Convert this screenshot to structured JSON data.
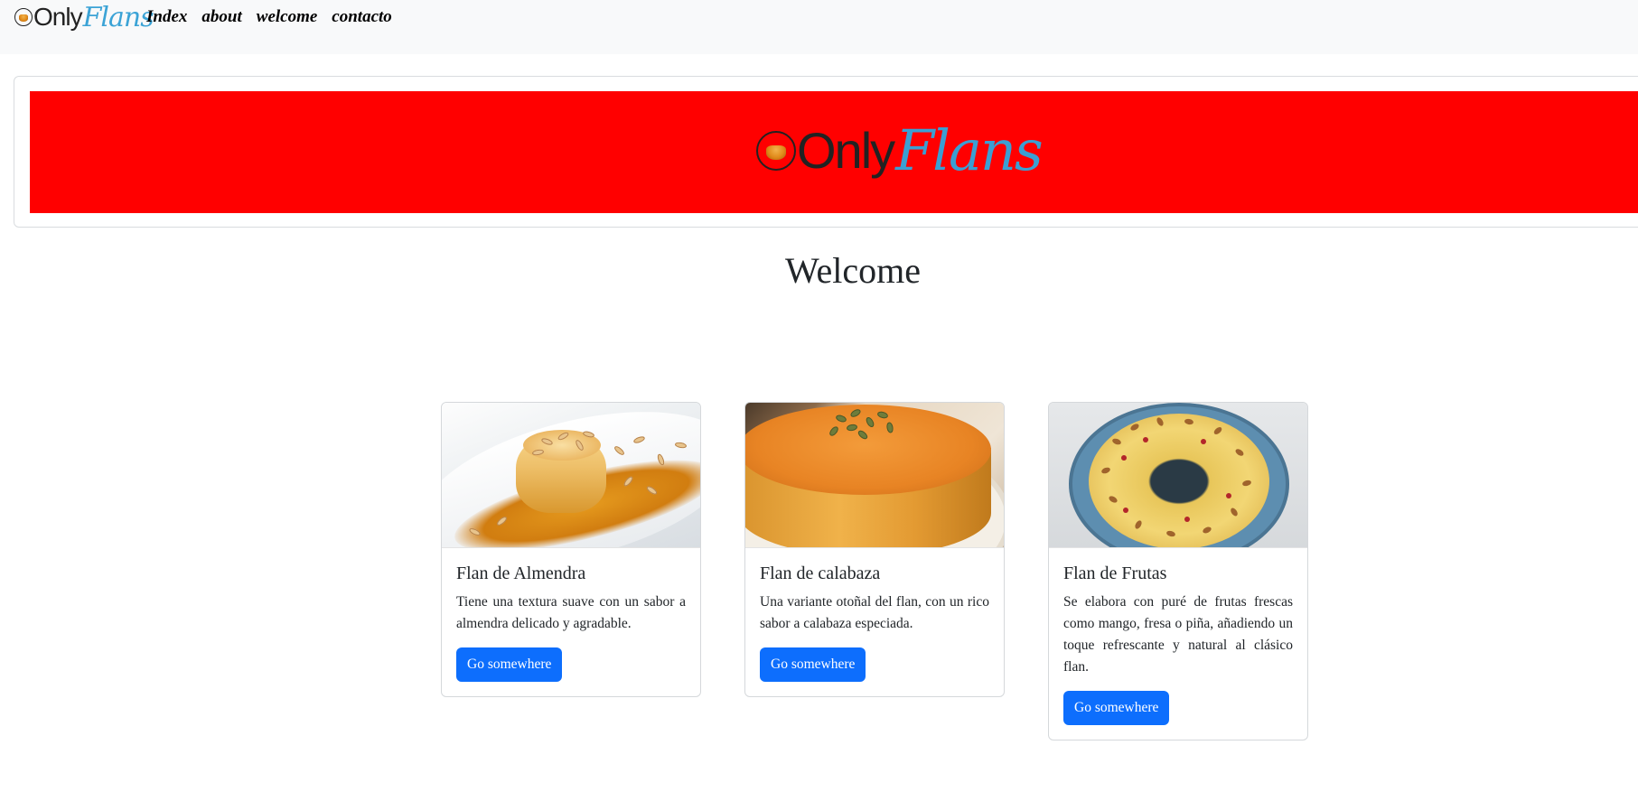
{
  "navbar": {
    "brand": {
      "only": "Only",
      "flans": "Flans"
    },
    "links": [
      "Index",
      "about",
      "welcome",
      "contacto"
    ]
  },
  "banner": {
    "background_color": "#ff0000",
    "logo": {
      "only": "Only",
      "flans": "Flans"
    }
  },
  "main": {
    "heading": "Welcome",
    "cards": [
      {
        "image": "flan-almendra-photo",
        "title": "Flan de Almendra",
        "text": "Tiene una textura suave con un sabor a almendra delicado y agradable.",
        "button": "Go somewhere"
      },
      {
        "image": "flan-calabaza-photo",
        "title": "Flan de calabaza",
        "text": "Una variante otoñal del flan, con un rico sabor a calabaza especiada.",
        "button": "Go somewhere"
      },
      {
        "image": "flan-frutas-photo",
        "title": "Flan de Frutas",
        "text": "Se elabora con puré de frutas frescas como mango, fresa o piña, añadiendo un toque refrescante y natural al clásico flan.",
        "button": "Go somewhere"
      }
    ]
  },
  "colors": {
    "navbar_bg": "#f8f9fa",
    "button_primary": "#0d6efd",
    "logo_flans": "#3ba3d6"
  }
}
